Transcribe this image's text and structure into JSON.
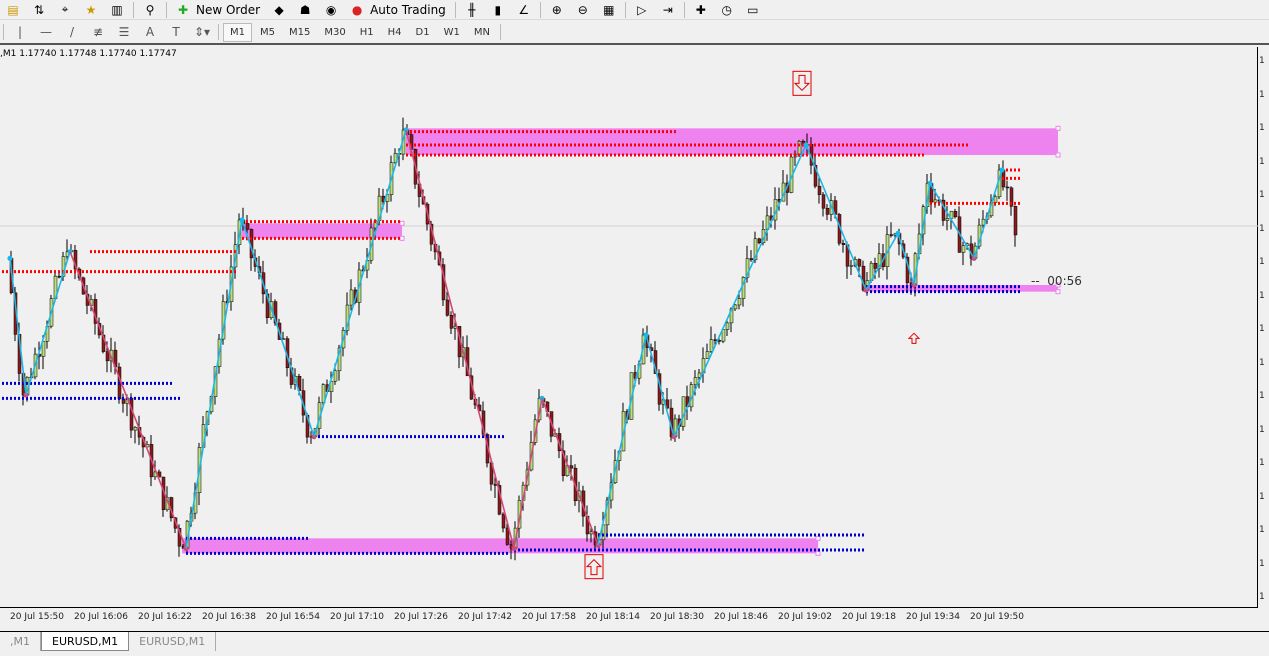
{
  "toolbar": {
    "new_order": "New Order",
    "auto_trading": "Auto Trading",
    "icons": [
      "profiles-icon",
      "market-watch-icon",
      "crosshair-icon",
      "favorites-icon",
      "history-icon",
      "search-icon",
      "new-order-icon",
      "metaeditor-icon",
      "signals-icon",
      "radio-icon",
      "auto-trading-icon",
      "bar-chart-icon",
      "candlestick-icon",
      "line-chart-icon",
      "zoom-in-icon",
      "zoom-out-icon",
      "tile-windows-icon",
      "auto-scroll-icon",
      "chart-shift-icon",
      "indicators-icon",
      "periods-icon",
      "templates-icon"
    ]
  },
  "drawing_tools": {
    "items": [
      "vertical-line",
      "horizontal-line",
      "trendline",
      "fibonacci-channel",
      "fibonacci-retracement",
      "text",
      "text-label",
      "arrows"
    ],
    "text_label": "A"
  },
  "timeframes": {
    "items": [
      "M1",
      "M5",
      "M15",
      "M30",
      "H1",
      "H4",
      "D1",
      "W1",
      "MN"
    ],
    "selected": "M1"
  },
  "chart": {
    "info": ",M1  1.17740 1.17748 1.17740 1.17747",
    "timer": "00:56",
    "axis_tick": "1",
    "time_labels": [
      "20 Jul 15:50",
      "20 Jul 16:06",
      "20 Jul 16:22",
      "20 Jul 16:38",
      "20 Jul 16:54",
      "20 Jul 17:10",
      "20 Jul 17:26",
      "20 Jul 17:42",
      "20 Jul 17:58",
      "20 Jul 18:14",
      "20 Jul 18:30",
      "20 Jul 18:46",
      "20 Jul 19:02",
      "20 Jul 19:18",
      "20 Jul 19:34",
      "20 Jul 19:50"
    ],
    "last": {
      "open": 1.1774,
      "high": 1.17748,
      "low": 1.1774,
      "close": 1.17747
    },
    "colors": {
      "bull": "#b8e07a",
      "bear": "#8b1a1a",
      "zigzag_up": "#1ab8e8",
      "zigzag_down": "#d04a78",
      "zone": "#ee82ee",
      "resistance": "#ff0000",
      "support": "#0000cc",
      "arrow": "#e00000"
    },
    "zigzag": [
      [
        "15:50",
        1.17733
      ],
      [
        "15:54",
        1.17651
      ],
      [
        "16:05",
        1.17737
      ],
      [
        "16:34",
        1.17559
      ],
      [
        "16:48",
        1.17756
      ],
      [
        "17:06",
        1.17626
      ],
      [
        "17:29",
        1.1781
      ],
      [
        "17:56",
        1.17559
      ],
      [
        "18:03",
        1.17649
      ],
      [
        "18:17",
        1.17561
      ],
      [
        "18:29",
        1.17687
      ],
      [
        "18:36",
        1.17626
      ],
      [
        "19:09",
        1.17801
      ],
      [
        "19:24",
        1.17714
      ],
      [
        "19:32",
        1.17748
      ],
      [
        "19:36",
        1.17717
      ],
      [
        "19:40",
        1.17778
      ],
      [
        "19:51",
        1.17733
      ],
      [
        "19:58",
        1.17786
      ],
      [
        "20:02",
        1.17747
      ]
    ],
    "zones": [
      [
        "17:29",
        "20:12",
        1.17811,
        1.17795
      ],
      [
        "16:48",
        "17:28",
        1.17754,
        1.17745
      ],
      [
        "16:33",
        "19:12",
        1.17565,
        1.17556
      ],
      [
        "19:24",
        "20:12",
        1.17717,
        1.17713
      ]
    ],
    "resistance_lines": [
      [
        "16:10",
        "16:47",
        1.17737
      ],
      [
        "15:48",
        "16:47",
        1.17725
      ],
      [
        "17:29",
        "18:37",
        1.17809
      ],
      [
        "17:29",
        "19:50",
        1.17801
      ],
      [
        "17:29",
        "19:39",
        1.17795
      ],
      [
        "16:48",
        "17:28",
        1.17755
      ],
      [
        "16:48",
        "17:28",
        1.17745
      ],
      [
        "19:40",
        "20:03",
        1.17766
      ],
      [
        "19:58",
        "20:03",
        1.17786
      ],
      [
        "19:58",
        "20:03",
        1.17781
      ]
    ],
    "support_lines": [
      [
        "15:48",
        "16:31",
        1.17658
      ],
      [
        "15:48",
        "16:33",
        1.17649
      ],
      [
        "17:06",
        "17:54",
        1.17626
      ],
      [
        "16:34",
        "17:05",
        1.17565
      ],
      [
        "16:34",
        "17:55",
        1.17556
      ],
      [
        "18:17",
        "19:24",
        1.17567
      ],
      [
        "17:56",
        "19:24",
        1.17558
      ],
      [
        "19:24",
        "20:03",
        1.17716
      ],
      [
        "19:24",
        "20:03",
        1.17713
      ]
    ],
    "signals": [
      {
        "type": "sell-arrow",
        "time": "19:08",
        "price": 1.17838
      },
      {
        "type": "buy-arrow",
        "time": "18:16",
        "price": 1.17548
      },
      {
        "type": "buy-arrow-small",
        "time": "19:36",
        "price": 1.17685
      }
    ]
  },
  "tabs": [
    {
      "label": ",M1"
    },
    {
      "label": "EURUSD,M1",
      "active": true
    },
    {
      "label": "EURUSD,M1"
    }
  ]
}
